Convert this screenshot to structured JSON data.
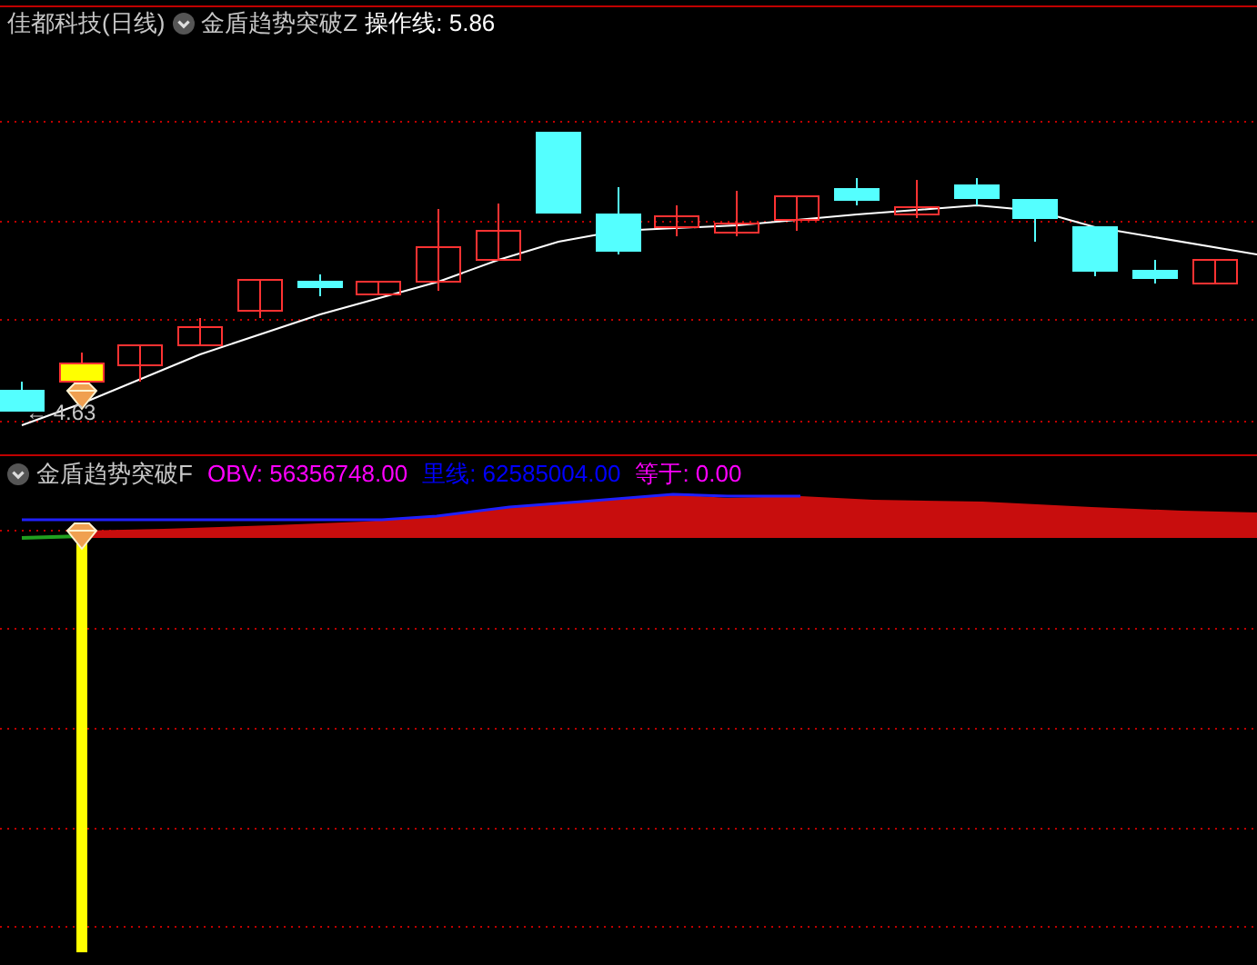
{
  "main_pane": {
    "stock_title": "佳都科技(日线)",
    "indicator": "金盾趋势突破Z",
    "readouts": [
      {
        "text": "操作线: 5.86",
        "color": "#ffffff"
      }
    ],
    "low_label": "← 4.63"
  },
  "sub_pane": {
    "indicator": "金盾趋势突破F",
    "readouts": [
      {
        "text": "OBV: 56356748.00",
        "color": "#ff00ff"
      },
      {
        "text": "里线: 62585004.00",
        "color": "#0000ff"
      },
      {
        "text": "等于: 0.00",
        "color": "#ff00ff"
      }
    ]
  }
}
